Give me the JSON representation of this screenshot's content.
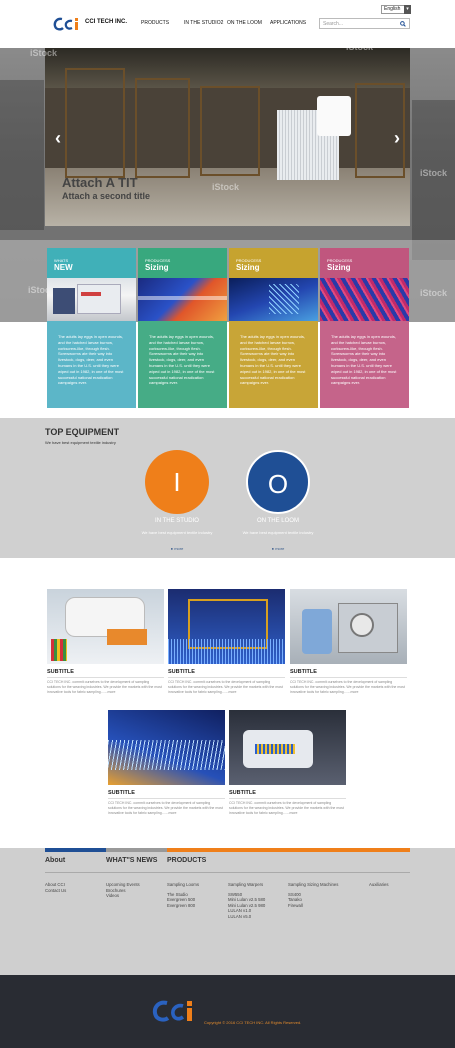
{
  "header": {
    "language": "English",
    "brand": "CCI TECH INC.",
    "nav": [
      "PRODUCTS",
      "IN THE STUDIO2",
      "ON THE LOOM",
      "APPLICATIONS"
    ],
    "search_placeholder": "Search..."
  },
  "hero": {
    "title": "Attach A TIT",
    "subtitle": "Attach a second title",
    "watermark": "iStock"
  },
  "cards": [
    {
      "kicker": "WHATS",
      "title": "NEW",
      "text": "The adults lay eggs in open wounds, and the hatched larvae burrow, corkscrew-like, through flesh. Screwworms ate their way into livestock, dogs, deer, and even humans in the U.S. until they were wiped out in 1982, in one of the most successful national eradication campaigns ever.",
      "head_color": "#40b0b8",
      "body_color": "#5cb6c8"
    },
    {
      "kicker": "PRODUCESS",
      "title": "Sizing",
      "text": "The adults lay eggs in open wounds, and the hatched larvae burrow, corkscrew-like, through flesh. Screwworms ate their way into livestock, dogs, deer, and even humans in the U.S. until they were wiped out in 1982, in one of the most successful national eradication campaigns ever.",
      "head_color": "#38a87e",
      "body_color": "#46ac86"
    },
    {
      "kicker": "PRODUCESS",
      "title": "Sizing",
      "text": "The adults lay eggs in open wounds, and the hatched larvae burrow, corkscrew-like, through flesh. Screwworms ate their way into livestock, dogs, deer, and even humans in the U.S. until they were wiped out in 1982, in one of the most successful national eradication campaigns ever.",
      "head_color": "#c6a32f",
      "body_color": "#c8a537"
    },
    {
      "kicker": "PRODUCESS",
      "title": "Sizing",
      "text": "The adults lay eggs in open wounds, and the hatched larvae burrow, corkscrew-like, through flesh. Screwworms ate their way into livestock, dogs, deer, and even humans in the U.S. until they were wiped out in 1982, in one of the most successful national eradication campaigns ever.",
      "head_color": "#c0567e",
      "body_color": "#c5648a"
    }
  ],
  "equipment": {
    "title": "TOP EQUIPMENT",
    "subtitle": "We have best equipment textile industry",
    "items": [
      {
        "letter": "I",
        "label": "IN THE STUDIO",
        "desc": "We have best equipment textile industry",
        "more": "more",
        "color": "#ef7f1a"
      },
      {
        "letter": "O",
        "label": "ON THE LOOM",
        "desc": "We have best equipment textile industry",
        "more": "more",
        "color": "#1f4f95"
      }
    ]
  },
  "products": {
    "items": [
      {
        "subtitle": "SUBTITLE",
        "text": "CCI TECH INC. commit ourselves to the development of sampling solutions for the weaving industries. We provide the markets with the most innovative tools for fabric sampling.......more"
      },
      {
        "subtitle": "SUBTITLE",
        "text": "CCI TECH INC. commit ourselves to the development of sampling solutions for the weaving industries. We provide the markets with the most innovative tools for fabric sampling.......more"
      },
      {
        "subtitle": "SUBTITLE",
        "text": "CCI TECH INC. commit ourselves to the development of sampling solutions for the weaving industries. We provide the markets with the most innovative tools for fabric sampling.......more"
      },
      {
        "subtitle": "SUBTITLE",
        "text": "CCI TECH INC. commit ourselves to the development of sampling solutions for the weaving industries. We provide the markets with the most innovative tools for fabric sampling.......more"
      },
      {
        "subtitle": "SUBTITLE",
        "text": "CCI TECH INC. commit ourselves to the development of sampling solutions for the weaving industries. We provide the markets with the most innovative tools for fabric sampling.......more"
      }
    ]
  },
  "footer": {
    "headings": [
      "About",
      "WHAT''S NEWS",
      "PRODUCTS"
    ],
    "about": [
      "About CCI",
      "Contact Us"
    ],
    "news": [
      "Upcoming Events",
      "Brochures",
      "Videos"
    ],
    "looms": {
      "head": "Sampling Looms",
      "items": [
        "The Studio",
        "Evergreen 500",
        "Evergreen 800"
      ]
    },
    "warpers": {
      "head": "Sampling Warpers",
      "items": [
        "SW550",
        "Mini Lulan v2.5 580",
        "Mini Lulan v2.5 980",
        "LULAN v1.0",
        "LULAN v5.0"
      ]
    },
    "sizing": {
      "head": "Sampling Sizing Machines",
      "items": [
        "SS400",
        "Tanako",
        "Firewall"
      ]
    },
    "aux": {
      "head": "Auxiliaries"
    }
  },
  "bottom": {
    "copyright": "Copyright © 2016 CCI TECH INC.  All Rights Reserved."
  }
}
